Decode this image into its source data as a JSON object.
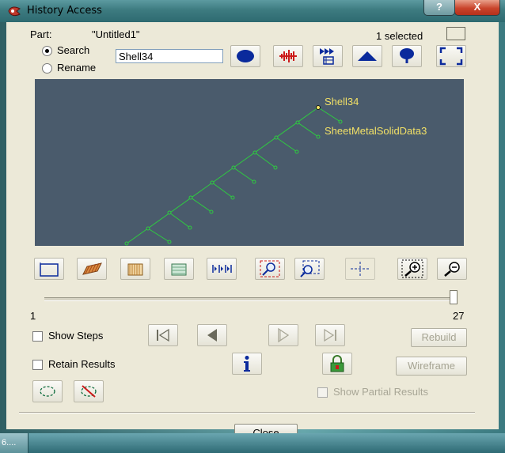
{
  "window": {
    "title": "History Access",
    "help_label": "?",
    "close_label": "X"
  },
  "part": {
    "label": "Part:",
    "name": "\"Untitled1\"",
    "selected_text": "1 selected"
  },
  "mode": {
    "search_label": "Search",
    "rename_label": "Rename",
    "selected": "Search",
    "field_value": "Shell34"
  },
  "viewport": {
    "background": "#4a5b6c",
    "line_color": "#2ecc40",
    "label_color": "#f2e066",
    "labels": [
      "Shell34",
      "SheetMetalSolidData3"
    ]
  },
  "slider": {
    "min_label": "1",
    "max_label": "27",
    "min": 1,
    "max": 27,
    "value": 27
  },
  "options": {
    "show_steps_label": "Show Steps",
    "retain_results_label": "Retain Results",
    "show_partial_label": "Show Partial Results"
  },
  "buttons": {
    "rebuild_label": "Rebuild",
    "wireframe_label": "Wireframe",
    "bottom_label": "Close"
  },
  "taskbar": {
    "item_label": "6...."
  },
  "colors": {
    "accent_blue": "#0a2a9c",
    "danger_red": "#cc1a1a"
  }
}
